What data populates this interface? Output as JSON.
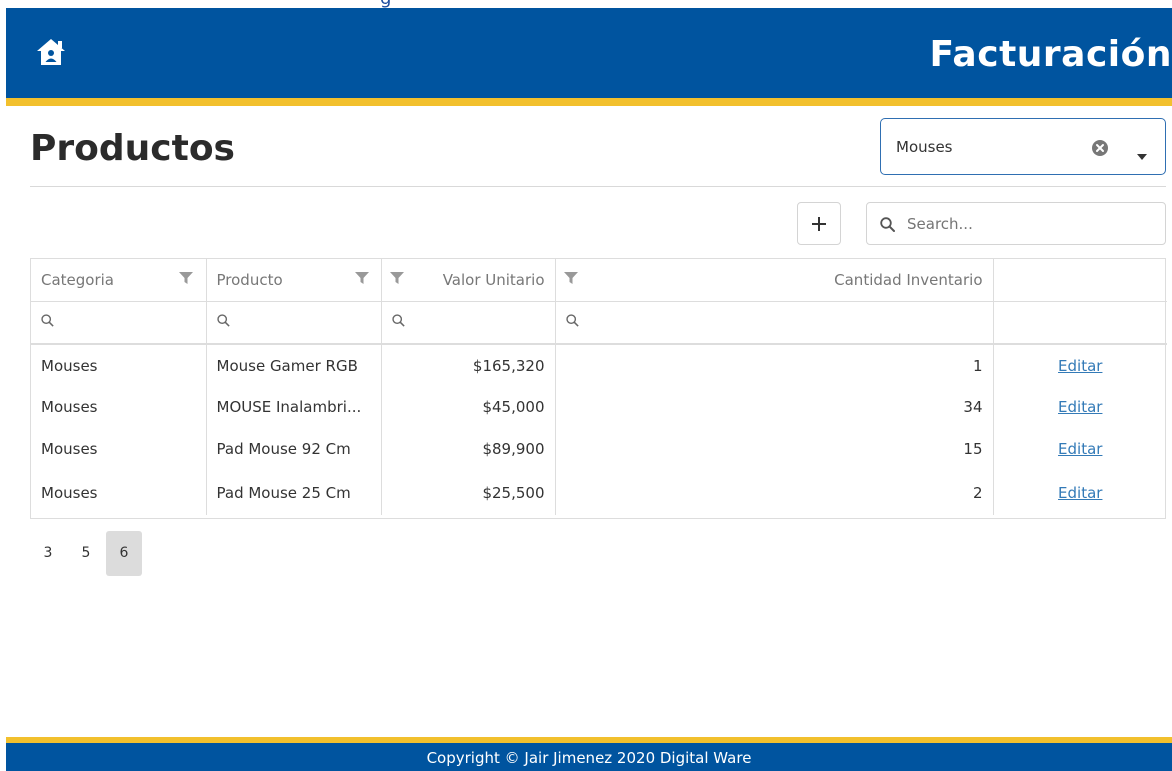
{
  "top_strip": {
    "text": "g"
  },
  "header": {
    "brand": "Facturación"
  },
  "page": {
    "title": "Productos"
  },
  "category_filter": {
    "value": "Mouses"
  },
  "toolbar": {
    "search_placeholder": "Search..."
  },
  "table": {
    "columns": [
      "Categoria",
      "Producto",
      "Valor Unitario",
      "Cantidad Inventario",
      ""
    ],
    "rows": [
      {
        "categoria": "Mouses",
        "producto": "Mouse Gamer RGB",
        "valor": "$165,320",
        "cantidad": "1",
        "action": "Editar"
      },
      {
        "categoria": "Mouses",
        "producto": "MOUSE Inalambri...",
        "valor": "$45,000",
        "cantidad": "34",
        "action": "Editar"
      },
      {
        "categoria": "Mouses",
        "producto": "Pad Mouse 92 Cm",
        "valor": "$89,900",
        "cantidad": "15",
        "action": "Editar"
      },
      {
        "categoria": "Mouses",
        "producto": "Pad Mouse 25 Cm",
        "valor": "$25,500",
        "cantidad": "2",
        "action": "Editar"
      }
    ]
  },
  "pagination": {
    "pages": [
      "3",
      "5",
      "6"
    ],
    "active": "6"
  },
  "footer": {
    "text": "Copyright © Jair Jimenez 2020 Digital Ware"
  },
  "colors": {
    "primary": "#00549f",
    "accent": "#f2c02d",
    "link": "#337ab7"
  },
  "icons": {
    "home": "home-icon",
    "clear": "clear-icon",
    "dropdown": "chevron-down-icon",
    "add": "plus-icon",
    "search": "search-icon",
    "filter": "filter-icon"
  }
}
